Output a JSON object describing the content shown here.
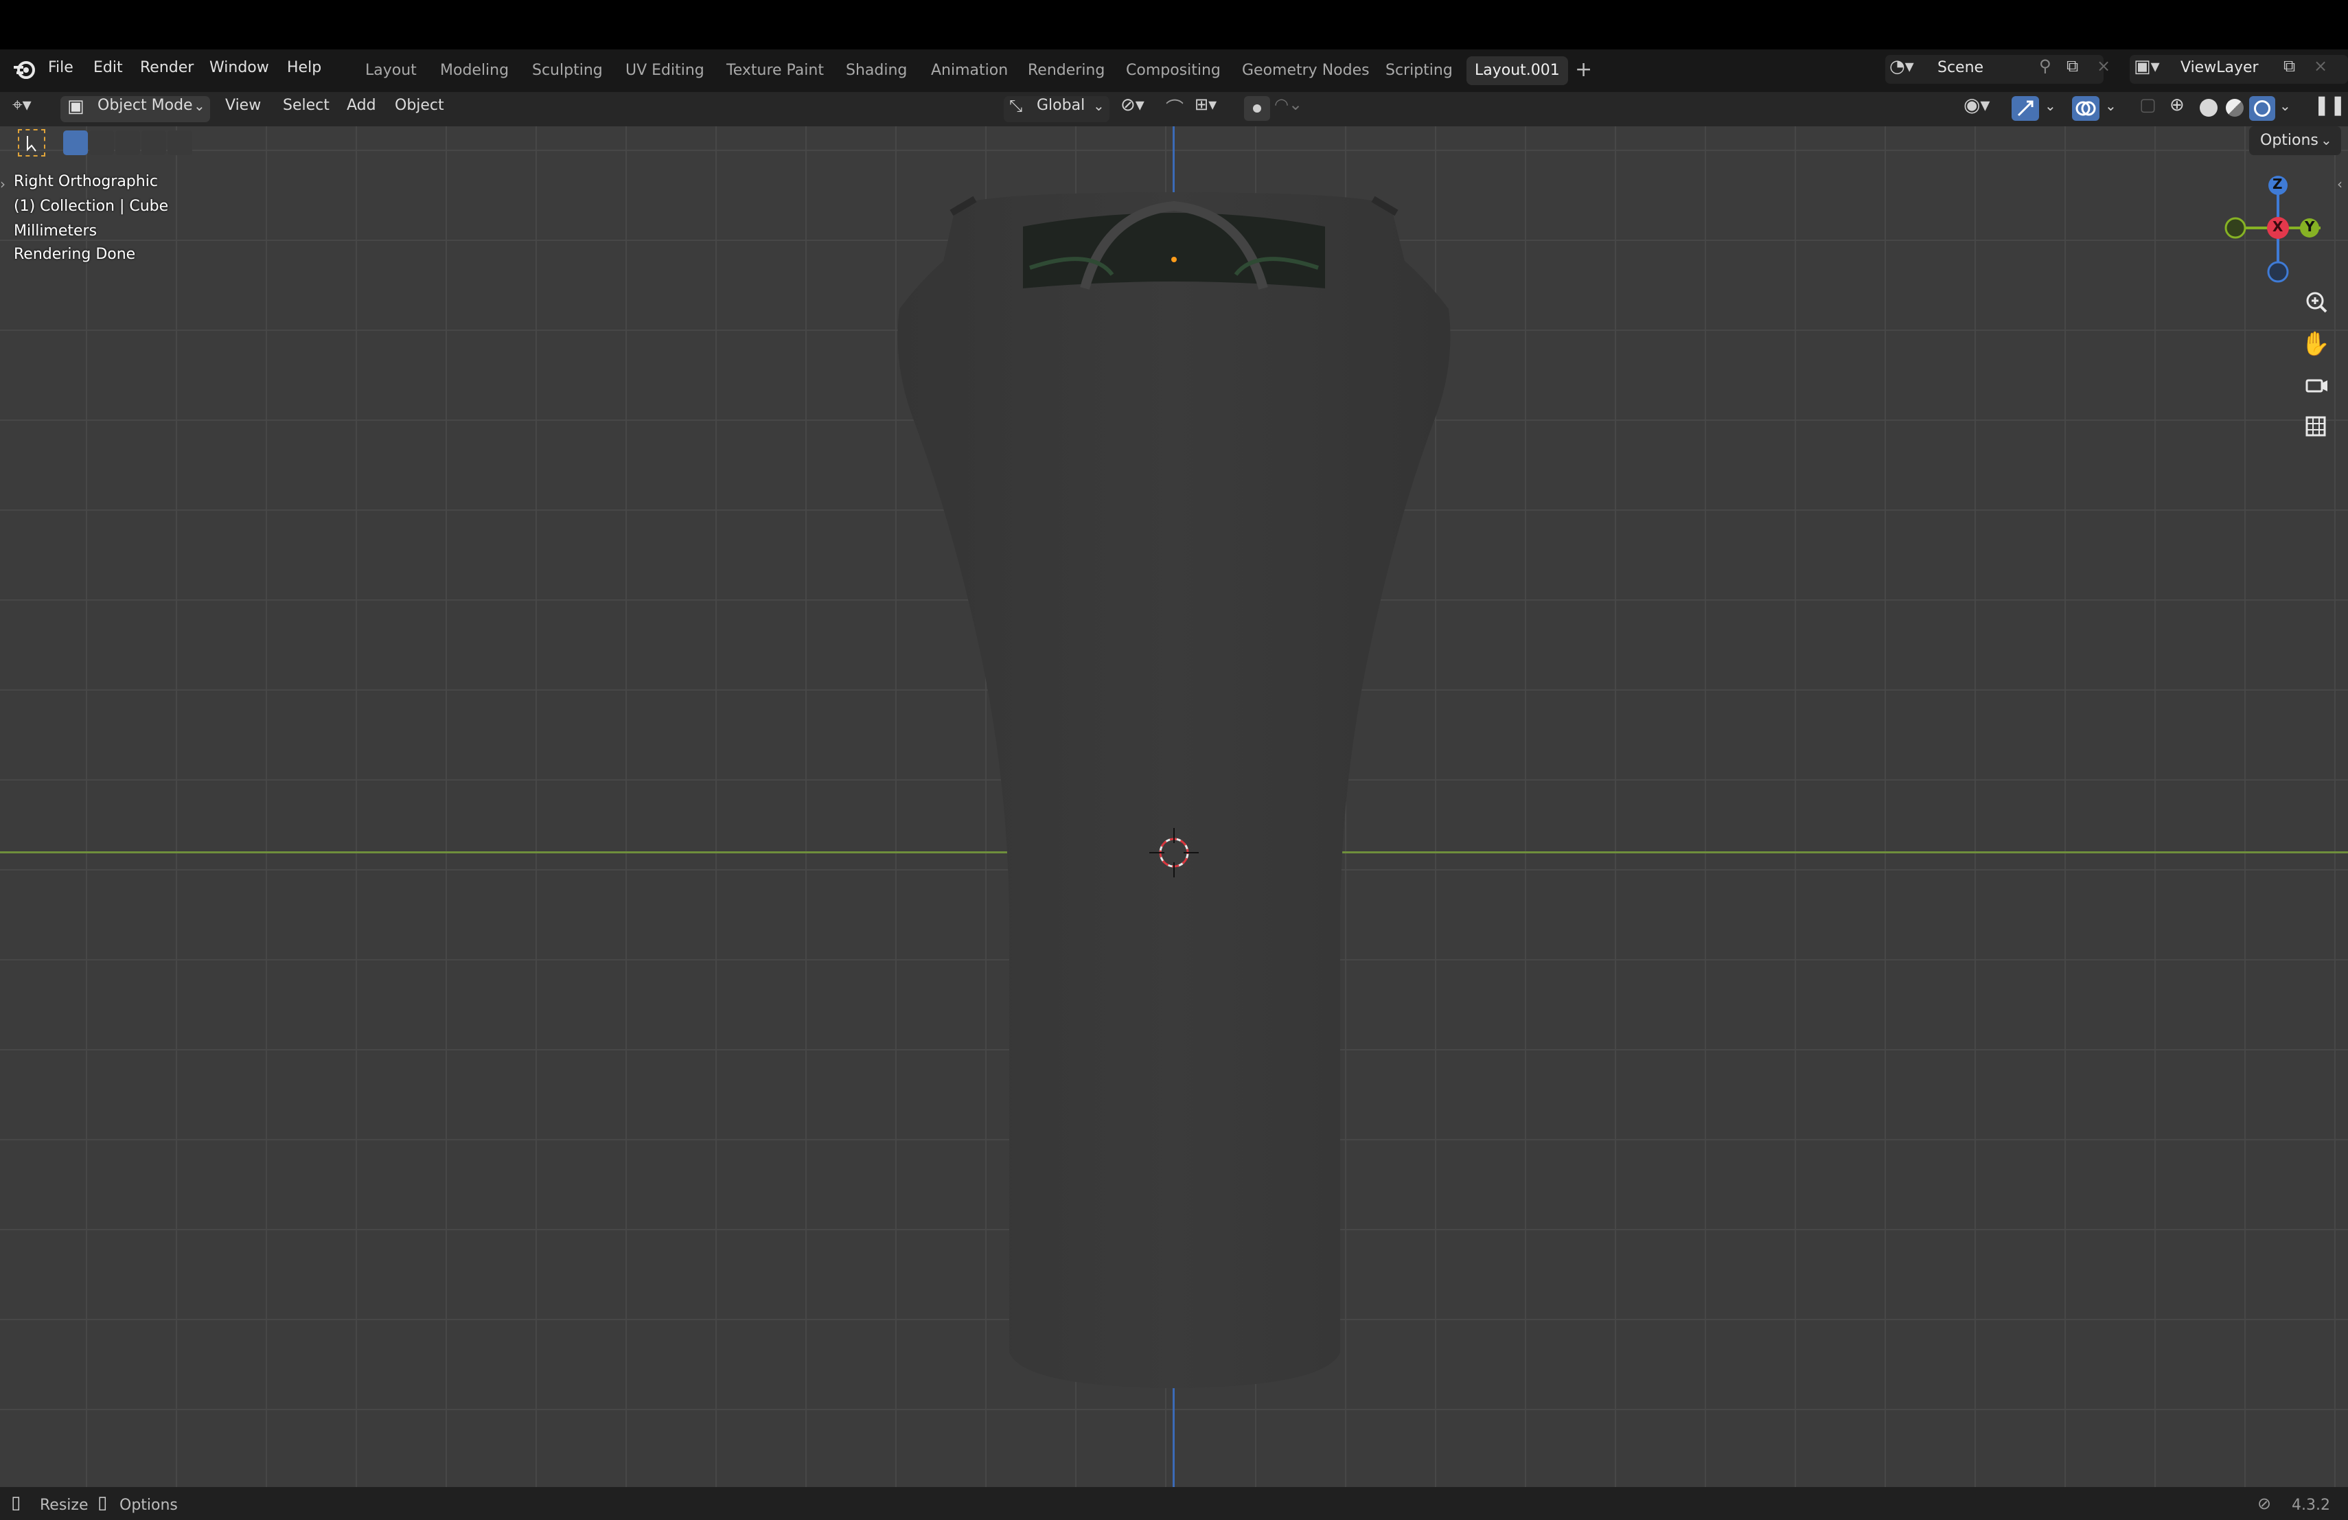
{
  "app_menu": [
    "File",
    "Edit",
    "Render",
    "Window",
    "Help"
  ],
  "workspace_tabs": [
    "Layout",
    "Modeling",
    "Sculpting",
    "UV Editing",
    "Texture Paint",
    "Shading",
    "Animation",
    "Rendering",
    "Compositing",
    "Geometry Nodes",
    "Scripting",
    "Layout.001"
  ],
  "active_tab": "Layout.001",
  "scene": {
    "label": "Scene"
  },
  "view_layer": {
    "label": "ViewLayer"
  },
  "header": {
    "mode": "Object Mode",
    "menus": [
      "View",
      "Select",
      "Add",
      "Object"
    ],
    "transform_orientation": "Global",
    "options_label": "Options"
  },
  "viewport": {
    "view_name": "Right Orthographic",
    "collection_info": "(1) Collection | Cube",
    "units": "Millimeters",
    "render_status": "Rendering Done"
  },
  "gizmo": {
    "x": "X",
    "y": "Y",
    "z": "Z"
  },
  "status_bar": {
    "resize": "Resize",
    "options": "Options",
    "version": "4.3.2"
  },
  "colors": {
    "accent_blue": "#4772b3",
    "axis_x": "#e3384c",
    "axis_y": "#86b224",
    "axis_z": "#3f7bd6",
    "y_axis_line": "#6f8f3c",
    "z_axis_line": "#3b6ab6",
    "origin_dot": "#ff9c1a"
  },
  "icons": [
    "blender-logo-icon",
    "add-workspace-icon",
    "scene-icon",
    "pin-icon",
    "new-scene-icon",
    "close-icon",
    "view-layer-icon",
    "editor-type-icon",
    "object-mode-icon",
    "select-box-icon",
    "transform-pivot-icon",
    "snap-icon",
    "proportional-edit-icon",
    "visibility-icon",
    "gizmo-icon",
    "overlay-icon",
    "xray-icon",
    "wireframe-shading-icon",
    "solid-shading-icon",
    "material-shading-icon",
    "rendered-shading-icon",
    "zoom-icon",
    "pan-hand-icon",
    "camera-view-icon",
    "ortho-grid-icon",
    "mouse-icon"
  ]
}
